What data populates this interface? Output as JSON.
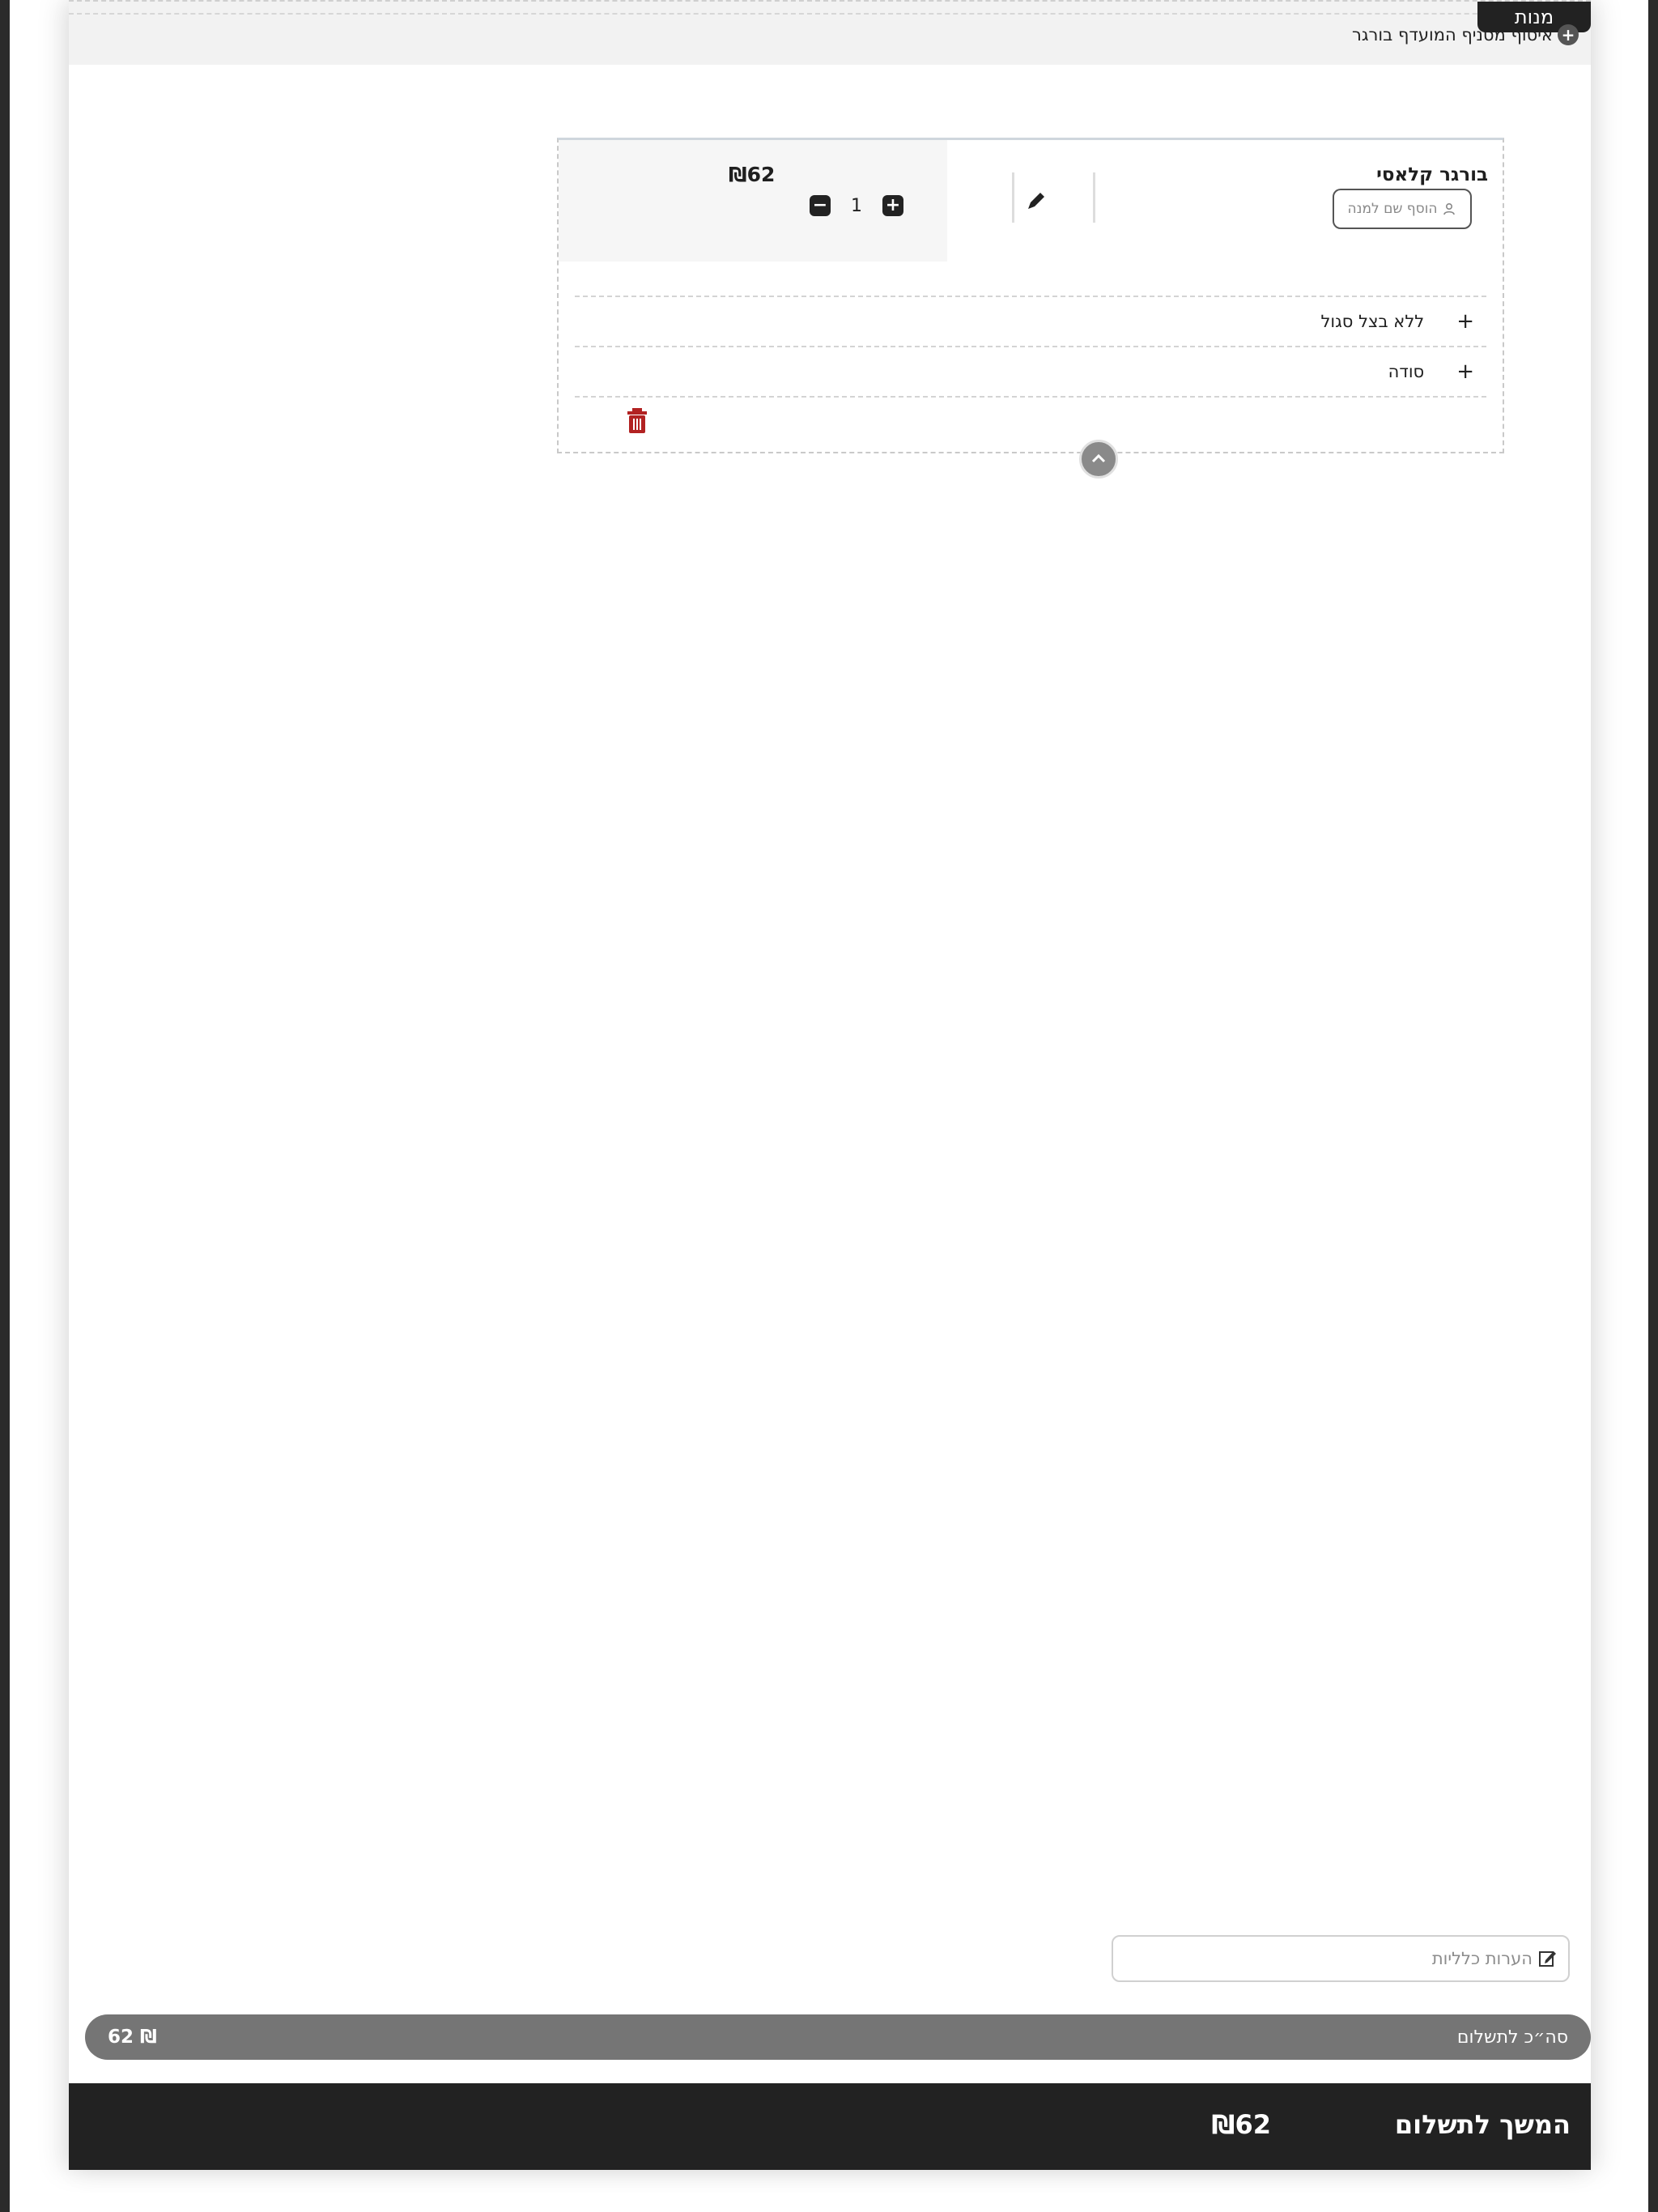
{
  "top": {
    "tab_label": "מנות",
    "add_extra_text": "איסוף מסניף המועדף בורגר"
  },
  "item": {
    "name": "בורגר קלאסי",
    "add_name_placeholder": "הוסף שם למנה",
    "price": "₪62",
    "quantity": "1",
    "modifiers": [
      {
        "label": "ללא בצל סגול"
      },
      {
        "label": "סודה"
      }
    ]
  },
  "notes": {
    "placeholder": "הערות כלליות"
  },
  "total": {
    "label": "סה״כ לתשלום",
    "amount": "₪ 62"
  },
  "checkout": {
    "label": "המשך לתשלום",
    "price": "₪62"
  },
  "icons": {
    "edit": "pencil-icon",
    "increase": "plus-square-icon",
    "decrease": "minus-square-icon",
    "delete": "trash-icon",
    "collapse": "chevron-up-icon",
    "person": "person-icon",
    "notes": "edit-note-icon"
  },
  "colors": {
    "dark": "#222222",
    "trash": "#b22222",
    "total_bar": "#757575"
  }
}
